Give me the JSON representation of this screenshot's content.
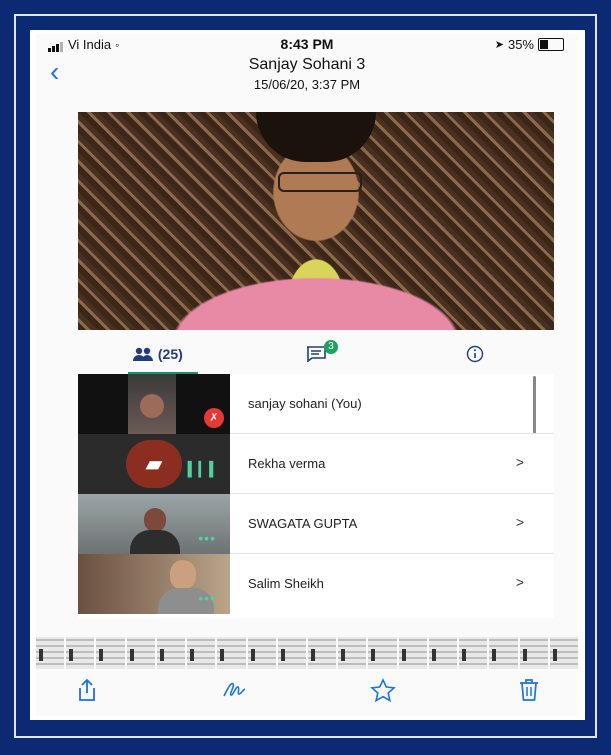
{
  "status_bar": {
    "carrier": "Vi India",
    "time": "8:43 PM",
    "battery": "35%"
  },
  "header": {
    "title": "Sanjay Sohani 3",
    "subtitle": "15/06/20, 3:37 PM"
  },
  "tabs": {
    "people_count": "(25)",
    "chat_badge": "3"
  },
  "participants": [
    {
      "name": "sanjay sohani (You)"
    },
    {
      "name": "Rekha verma"
    },
    {
      "name": "SWAGATA GUPTA"
    },
    {
      "name": "Salim Sheikh"
    }
  ],
  "colors": {
    "accent": "#1a73e8",
    "badge": "#18a55f",
    "frame": "#0b2a73"
  },
  "icons": {
    "back": "chevron-left-icon",
    "people": "people-icon",
    "chat": "chat-icon",
    "info": "info-icon",
    "share": "share-icon",
    "markup": "signature-icon",
    "favorite": "star-icon",
    "delete": "trash-icon"
  }
}
